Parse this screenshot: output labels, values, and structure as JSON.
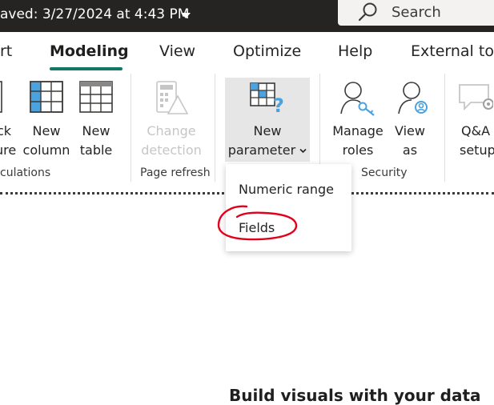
{
  "titlebar": {
    "saved_text": "aved: 3/27/2024 at 4:43 PM",
    "search_label": "Search"
  },
  "tabs": [
    {
      "label": "rt"
    },
    {
      "label": "Modeling",
      "active": true
    },
    {
      "label": "View"
    },
    {
      "label": "Optimize"
    },
    {
      "label": "Help"
    },
    {
      "label": "External too"
    }
  ],
  "ribbon": {
    "quick_measure": {
      "line1": "ck",
      "line2": "ure"
    },
    "new_column": {
      "line1": "New",
      "line2": "column"
    },
    "new_table": {
      "line1": "New",
      "line2": "table"
    },
    "change_detection": {
      "line1": "Change",
      "line2": "detection"
    },
    "new_parameter": {
      "line1": "New",
      "line2": "parameter"
    },
    "manage_roles": {
      "line1": "Manage",
      "line2": "roles"
    },
    "view_as": {
      "line1": "View",
      "line2": "as"
    },
    "qa_setup": {
      "line1": "Q&A",
      "line2": "setup"
    },
    "groups": {
      "calculations": "culations",
      "page_refresh": "Page refresh",
      "security": "Security"
    }
  },
  "dropdown": {
    "items": [
      {
        "label": "Numeric range"
      },
      {
        "label": "Fields"
      }
    ]
  },
  "canvas": {
    "bottom_text": "Build visuals with your data"
  },
  "colors": {
    "titlebar": "#252423",
    "accent": "#117865",
    "icon_blue": "#4aa3df",
    "annotation_red": "#e3001b"
  }
}
